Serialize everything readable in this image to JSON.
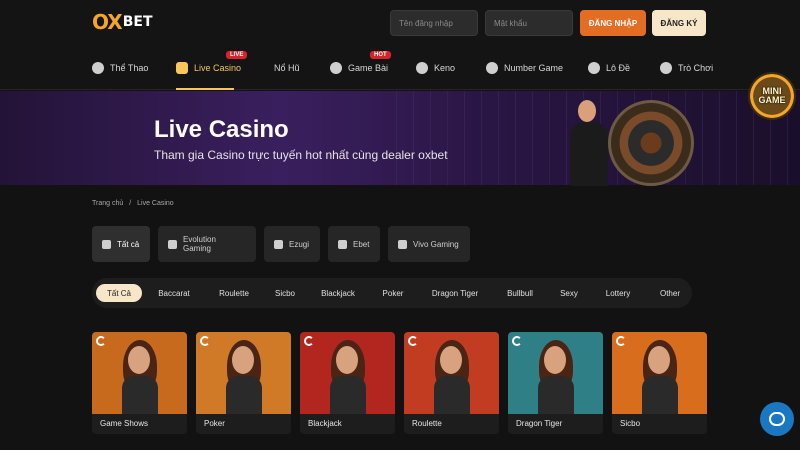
{
  "header": {
    "logo_ox": "OX",
    "logo_bet": "BET",
    "username_placeholder": "Tên đăng nhập",
    "password_placeholder": "Mật khẩu",
    "login_label": "ĐĂNG NHẬP",
    "register_label": "ĐĂNG KÝ"
  },
  "nav": {
    "items": [
      {
        "label": "Thể Thao",
        "icon": "soccer-ball-icon"
      },
      {
        "label": "Live Casino",
        "icon": "mask-icon",
        "badge": "LIVE"
      },
      {
        "label": "Nổ Hũ",
        "icon": ""
      },
      {
        "label": "Game Bài",
        "icon": "spade-icon",
        "badge": "HOT"
      },
      {
        "label": "Keno",
        "icon": "keno-ball-icon"
      },
      {
        "label": "Number Game",
        "icon": "number-wheel-icon"
      },
      {
        "label": "Lô Đề",
        "icon": "lottery-grid-icon"
      },
      {
        "label": "Trò Chơi",
        "icon": "gamepad-icon"
      }
    ]
  },
  "banner": {
    "title": "Live Casino",
    "subtitle": "Tham gia Casino trực tuyến hot nhất cùng dealer oxbet"
  },
  "mini_game": {
    "label_1": "MINI",
    "label_2": "GAME"
  },
  "breadcrumb": {
    "home": "Trang chủ",
    "separator": "/",
    "current": "Live Casino"
  },
  "providers": [
    {
      "label": "Tất cả",
      "icon": "grid-icon"
    },
    {
      "label": "Evolution Gaming",
      "icon": "evolution-icon"
    },
    {
      "label": "Ezugi",
      "icon": "ezugi-icon"
    },
    {
      "label": "Ebet",
      "icon": "ebet-icon"
    },
    {
      "label": "Vivo Gaming",
      "icon": "vivo-icon"
    }
  ],
  "categories": [
    "Tất Cả",
    "Baccarat",
    "Roulette",
    "Sicbo",
    "Blackjack",
    "Poker",
    "Dragon Tiger",
    "Bullbull",
    "Sexy",
    "Lottery",
    "Other"
  ],
  "games": [
    {
      "label": "Game Shows",
      "bg": "#c86a1e"
    },
    {
      "label": "Poker",
      "bg": "#d07a28"
    },
    {
      "label": "Blackjack",
      "bg": "#b2261f"
    },
    {
      "label": "Roulette",
      "bg": "#c23c22"
    },
    {
      "label": "Dragon Tiger",
      "bg": "#2f7f86"
    },
    {
      "label": "Sicbo",
      "bg": "#d86d1e"
    }
  ],
  "colors": {
    "accent": "#f7c75a",
    "login": "#e46d24",
    "register": "#f7e6c8",
    "badge": "#d8232a",
    "chat": "#1a78c2"
  }
}
